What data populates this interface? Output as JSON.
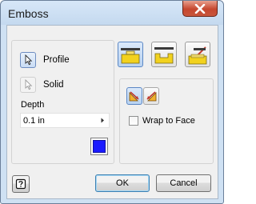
{
  "window": {
    "title": "Emboss"
  },
  "profile_group": {
    "profile_label": "Profile",
    "solid_label": "Solid",
    "depth_label": "Depth",
    "depth_value": "0.1 in"
  },
  "options_group": {
    "wrap_to_face_label": "Wrap to Face",
    "wrap_to_face_checked": false
  },
  "buttons": {
    "ok_label": "OK",
    "cancel_label": "Cancel"
  },
  "icons": {
    "close": "close-icon",
    "profile": "cursor-arrow-icon",
    "solid": "cursor-arrow-icon",
    "color": "color-swatch",
    "help": "help-icon"
  },
  "colors": {
    "emboss_color": "#1a1aff",
    "accent_yellow": "#f2d21e",
    "close_red": "#c6472f"
  }
}
